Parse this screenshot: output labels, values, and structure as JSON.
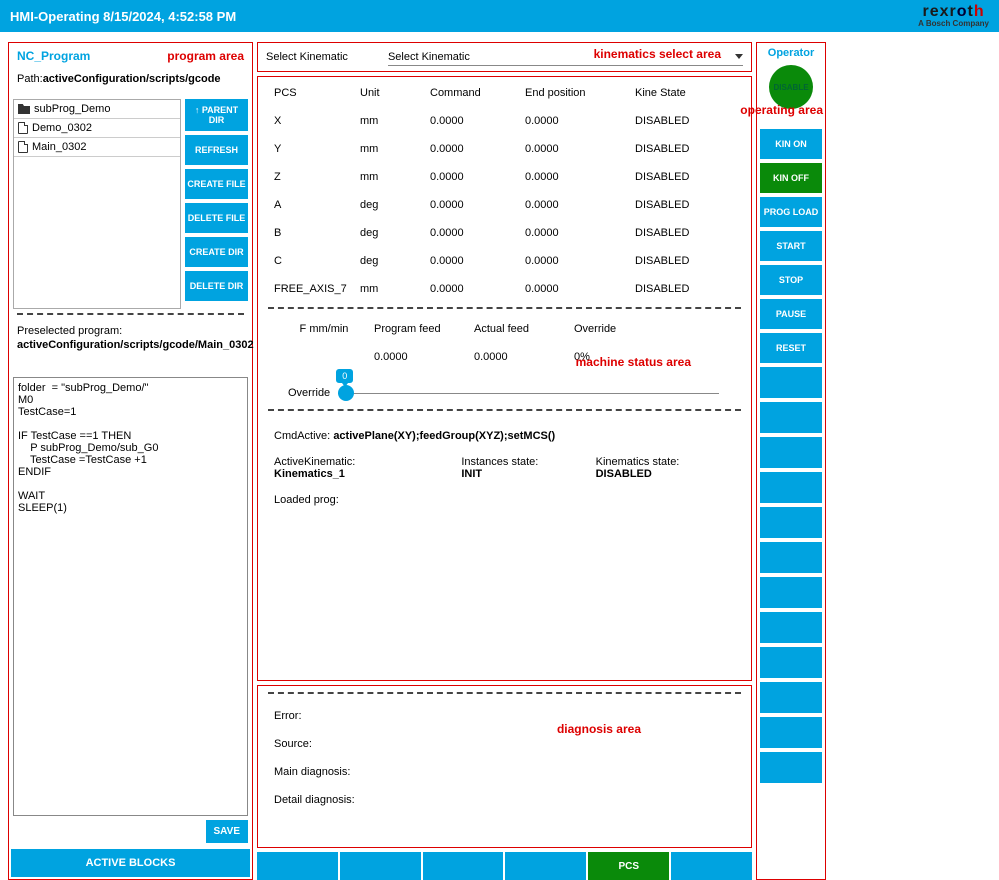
{
  "topbar": {
    "title": "HMI-Operating 8/15/2024, 4:52:58 PM",
    "brand": "rexroth",
    "brand_sub": "A Bosch Company"
  },
  "program": {
    "title": "NC_Program",
    "area_label": "program area",
    "path_label": "Path:",
    "path_value": "activeConfiguration/scripts/gcode",
    "files": [
      {
        "type": "folder",
        "name": "subProg_Demo"
      },
      {
        "type": "file",
        "name": "Demo_0302"
      },
      {
        "type": "file",
        "name": "Main_0302"
      }
    ],
    "buttons": {
      "parent_dir": "↑ PARENT DIR",
      "refresh": "REFRESH",
      "create_file": "CREATE FILE",
      "delete_file": "DELETE FILE",
      "create_dir": "CREATE DIR",
      "delete_dir": "DELETE DIR"
    },
    "presel_label": "Preselected program:",
    "presel_value": "activeConfiguration/scripts/gcode/Main_0302",
    "code": "folder  = \"subProg_Demo/\"\nM0\nTestCase=1\n\nIF TestCase ==1 THEN\n    P subProg_Demo/sub_G0\n    TestCase =TestCase +1\nENDIF\n\nWAIT\nSLEEP(1)",
    "save": "SAVE",
    "active_blocks": "ACTIVE BLOCKS"
  },
  "kinematics": {
    "select_label": "Select Kinematic",
    "dropdown_value": "Select Kinematic",
    "area_label": "kinematics select area"
  },
  "status": {
    "area_label": "machine status area",
    "headers": {
      "c1": "PCS",
      "c2": "Unit",
      "c3": "Command",
      "c4": "End position",
      "c5": "Kine State"
    },
    "rows": [
      {
        "c1": "X",
        "c2": "mm",
        "c3": "0.0000",
        "c4": "0.0000",
        "c5": "DISABLED"
      },
      {
        "c1": "Y",
        "c2": "mm",
        "c3": "0.0000",
        "c4": "0.0000",
        "c5": "DISABLED"
      },
      {
        "c1": "Z",
        "c2": "mm",
        "c3": "0.0000",
        "c4": "0.0000",
        "c5": "DISABLED"
      },
      {
        "c1": "A",
        "c2": "deg",
        "c3": "0.0000",
        "c4": "0.0000",
        "c5": "DISABLED"
      },
      {
        "c1": "B",
        "c2": "deg",
        "c3": "0.0000",
        "c4": "0.0000",
        "c5": "DISABLED"
      },
      {
        "c1": "C",
        "c2": "deg",
        "c3": "0.0000",
        "c4": "0.0000",
        "c5": "DISABLED"
      },
      {
        "c1": "FREE_AXIS_7",
        "c2": "mm",
        "c3": "0.0000",
        "c4": "0.0000",
        "c5": "DISABLED"
      }
    ],
    "feed_headers": {
      "c1": "F mm/min",
      "c2": "Program feed",
      "c3": "Actual feed",
      "c4": "Override"
    },
    "feed_row": {
      "c1": "",
      "c2": "0.0000",
      "c3": "0.0000",
      "c4": "0%"
    },
    "override_label": "Override",
    "override_value": "0",
    "cmd_active_label": "CmdActive:",
    "cmd_active_value": "activePlane(XY);feedGroup(XYZ);setMCS()",
    "active_kin_label": "ActiveKinematic:",
    "active_kin_value": "Kinematics_1",
    "inst_state_label": "Instances state:",
    "inst_state_value": "INIT",
    "kin_state_label": "Kinematics state:",
    "kin_state_value": "DISABLED",
    "loaded_prog_label": "Loaded prog:"
  },
  "diagnosis": {
    "area_label": "diagnosis area",
    "error_label": "Error:",
    "source_label": "Source:",
    "main_diag_label": "Main diagnosis:",
    "detail_diag_label": "Detail diagnosis:"
  },
  "bottom_btns": [
    "",
    "",
    "",
    "",
    "PCS",
    ""
  ],
  "operator": {
    "title": "Operator",
    "area_label": "operating area",
    "disable": "DISABLE",
    "buttons": [
      "KIN ON",
      "KIN OFF",
      "PROG LOAD",
      "START",
      "STOP",
      "PAUSE",
      "RESET"
    ]
  }
}
